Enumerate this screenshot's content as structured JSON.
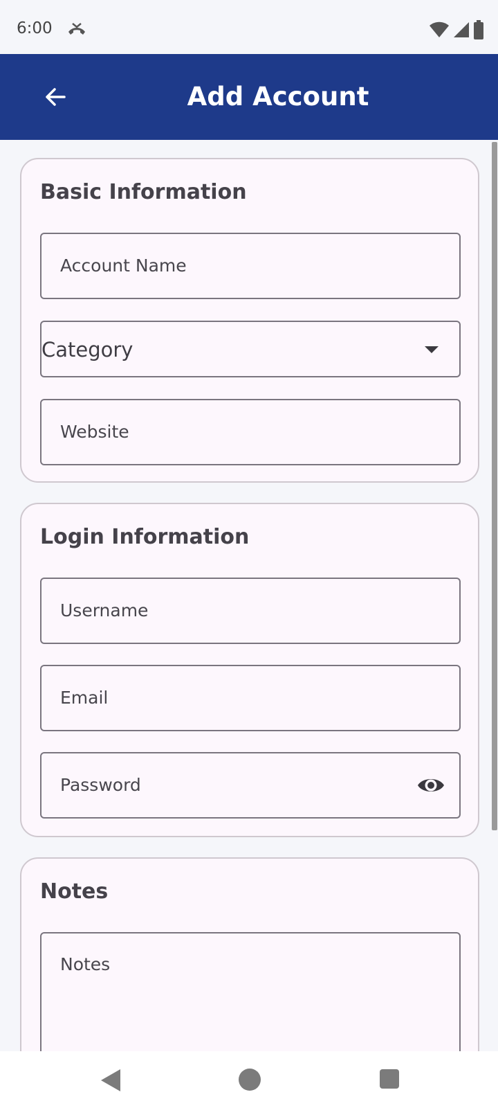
{
  "status_bar": {
    "time": "6:00"
  },
  "app_bar": {
    "title": "Add Account"
  },
  "basic_info": {
    "title": "Basic Information",
    "account_name_label": "Account Name",
    "category_label": "Category",
    "website_label": "Website"
  },
  "login_info": {
    "title": "Login Information",
    "username_label": "Username",
    "email_label": "Email",
    "password_label": "Password"
  },
  "notes": {
    "title": "Notes",
    "notes_label": "Notes"
  },
  "colors": {
    "app_bar": "#1e3a8a",
    "card_background": "#fdf7fd",
    "page_background": "#f5f6fa"
  }
}
